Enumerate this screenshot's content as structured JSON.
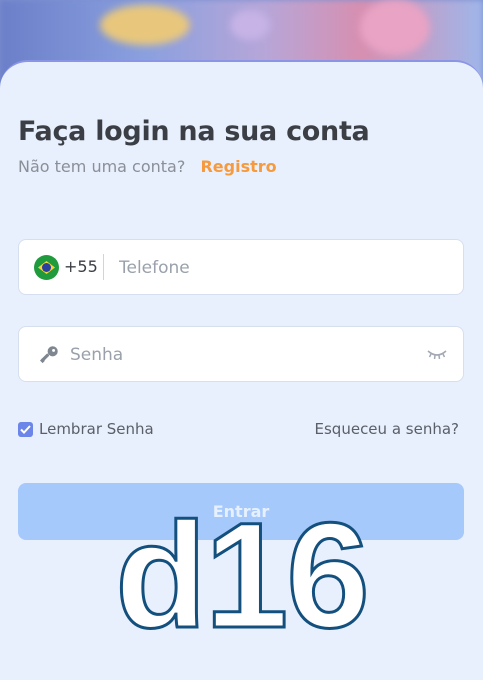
{
  "login": {
    "title": "Faça login na sua conta",
    "no_account_text": "Não tem uma conta?",
    "register_link": "Registro"
  },
  "phone": {
    "country_code": "+55",
    "placeholder": "Telefone",
    "flag_icon": "brazil-flag-icon"
  },
  "password": {
    "placeholder": "Senha",
    "key_icon": "key-icon",
    "toggle_icon": "eye-closed-icon"
  },
  "options": {
    "remember_label": "Lembrar Senha",
    "remember_checked": true,
    "forgot_link": "Esqueceu a senha?"
  },
  "submit_label": "Entrar",
  "watermark": "d16",
  "colors": {
    "accent": "#f59a3f",
    "button_bg": "#a6c9fb",
    "card_bg": "#e9f0fd",
    "checkbox": "#6b85e8"
  }
}
